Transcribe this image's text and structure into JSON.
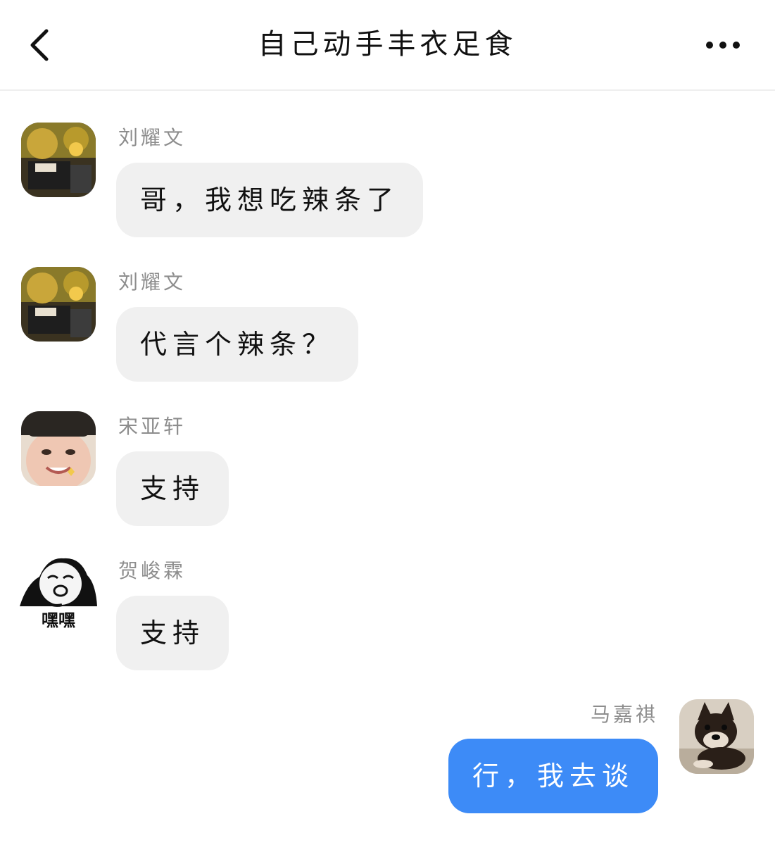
{
  "header": {
    "title": "自己动手丰衣足食"
  },
  "messages": [
    {
      "sender": "刘耀文",
      "text": "哥，我想吃辣条了",
      "avatar": "photo-boy-yellow-avatar",
      "side": "left"
    },
    {
      "sender": "刘耀文",
      "text": "代言个辣条？",
      "avatar": "photo-boy-yellow-avatar",
      "side": "left"
    },
    {
      "sender": "宋亚轩",
      "text": "支持",
      "avatar": "smiling-boy-avatar",
      "side": "left"
    },
    {
      "sender": "贺峻霖",
      "text": "支持",
      "avatar": "panda-meme-avatar",
      "avatar_caption": "嘿嘿",
      "side": "left"
    },
    {
      "sender": "马嘉祺",
      "text": "行，我去谈",
      "avatar": "shiba-dog-avatar",
      "side": "right"
    }
  ],
  "colors": {
    "bubble_other": "#f0f0f0",
    "bubble_mine": "#3d8bf7",
    "sender_text": "#8d8d8d"
  }
}
